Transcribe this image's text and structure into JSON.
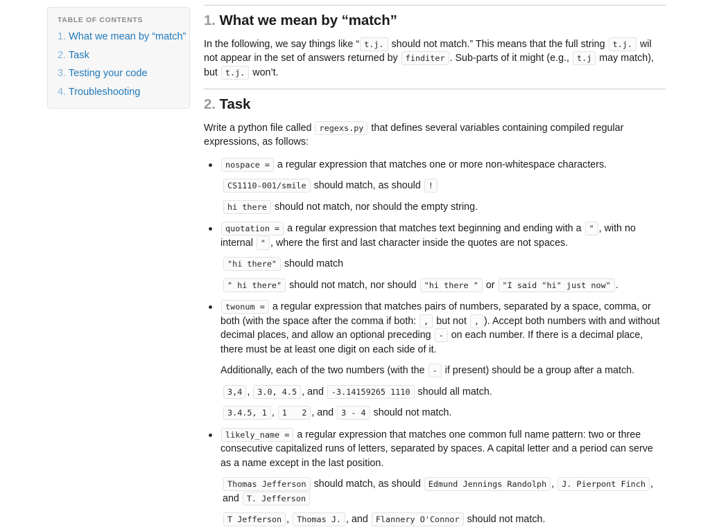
{
  "toc": {
    "title": "TABLE OF CONTENTS",
    "items": [
      {
        "num": "1.",
        "label": "What we mean by “match”"
      },
      {
        "num": "2.",
        "label": "Task"
      },
      {
        "num": "3.",
        "label": "Testing your code"
      },
      {
        "num": "4.",
        "label": "Troubleshooting"
      }
    ]
  },
  "sections": {
    "match": {
      "num": "1.",
      "title": "What we mean by “match”",
      "p1_a": "In the following, we say things like “",
      "p1_code1": "t.j.",
      "p1_b": "should not match.” This means that the full string",
      "p1_code2": "t.j.",
      "p1_c": "wil not appear in the set of answers returned by",
      "p1_code3": "finditer",
      "p1_d": ". Sub-parts of it might (e.g.,",
      "p1_code4": "t.j",
      "p1_e": "may match), but",
      "p1_code5": "t.j.",
      "p1_f": "won’t."
    },
    "task": {
      "num": "2.",
      "title": "Task",
      "intro_a": "Write a python file called",
      "intro_code": "regexs.py",
      "intro_b": "that defines several variables containing compiled regular expressions, as follows:",
      "bullets": [
        {
          "name": "nospace",
          "code": "nospace =",
          "desc": "a regular expression that matches one or more non-whitespace characters.",
          "lines": [
            {
              "parts": [
                {
                  "t": "code",
                  "v": "CS1110-001/smile"
                },
                {
                  "t": "text",
                  "v": "should match, as should"
                },
                {
                  "t": "code",
                  "v": "!"
                }
              ]
            },
            {
              "parts": [
                {
                  "t": "code",
                  "v": "hi there"
                },
                {
                  "t": "text",
                  "v": "should not match, nor should the empty string."
                }
              ]
            }
          ]
        },
        {
          "name": "quotation",
          "code": "quotation =",
          "desc_a": "a regular expression that matches text beginning and ending with a",
          "desc_code1": "\"",
          "desc_b": ", with no internal",
          "desc_code2": "\"",
          "desc_c": ", where the first and last character inside the quotes are not spaces.",
          "lines": [
            {
              "parts": [
                {
                  "t": "code",
                  "v": "\"hi there\""
                },
                {
                  "t": "text",
                  "v": "should match"
                }
              ]
            },
            {
              "parts": [
                {
                  "t": "code",
                  "v": "\" hi there\""
                },
                {
                  "t": "text",
                  "v": "should not match, nor should"
                },
                {
                  "t": "code",
                  "v": "\"hi there \""
                },
                {
                  "t": "text",
                  "v": "or"
                },
                {
                  "t": "code",
                  "v": "\"I said \"hi\" just now\""
                },
                {
                  "t": "text",
                  "v": "."
                }
              ]
            }
          ]
        },
        {
          "name": "twonum",
          "code": "twonum =",
          "desc_a": "a regular expression that matches pairs of numbers, separated by a space, comma, or both (with the space after the comma if both:",
          "desc_code1": ",",
          "desc_b": "but not",
          "desc_code2": ",",
          "desc_c": "). Accept both numbers with and without decimal places, and allow an optional preceding",
          "desc_code3": "-",
          "desc_d": "on each number. If there is a decimal place, there must be at least one digit on each side of it.",
          "extra_a": "Additionally, each of the two numbers (with the",
          "extra_code": "-",
          "extra_b": "if present) should be a group after a match.",
          "lines": [
            {
              "parts": [
                {
                  "t": "code",
                  "v": "3,4"
                },
                {
                  "t": "text",
                  "v": ","
                },
                {
                  "t": "code",
                  "v": "3.0, 4.5"
                },
                {
                  "t": "text",
                  "v": ", and"
                },
                {
                  "t": "code",
                  "v": "-3.14159265 1110"
                },
                {
                  "t": "text",
                  "v": "should all match."
                }
              ]
            },
            {
              "parts": [
                {
                  "t": "code",
                  "v": "3.4.5, 1"
                },
                {
                  "t": "text",
                  "v": ","
                },
                {
                  "t": "code",
                  "v": "1   2"
                },
                {
                  "t": "text",
                  "v": ", and"
                },
                {
                  "t": "code",
                  "v": "3 - 4"
                },
                {
                  "t": "text",
                  "v": "should not match."
                }
              ]
            }
          ]
        },
        {
          "name": "likely_name",
          "code": "likely_name =",
          "desc": "a regular expression that matches one common full name pattern: two or three consecutive capitalized runs of letters, separated by spaces. A capital letter and a period can serve as a name except in the last position.",
          "lines": [
            {
              "parts": [
                {
                  "t": "code",
                  "v": "Thomas Jefferson"
                },
                {
                  "t": "text",
                  "v": "should match, as should"
                },
                {
                  "t": "code",
                  "v": "Edmund Jennings Randolph"
                },
                {
                  "t": "text",
                  "v": ","
                },
                {
                  "t": "code",
                  "v": "J. Pierpont Finch"
                },
                {
                  "t": "text",
                  "v": ", and"
                },
                {
                  "t": "code",
                  "v": "T. Jefferson"
                }
              ]
            },
            {
              "parts": [
                {
                  "t": "code",
                  "v": "T Jefferson"
                },
                {
                  "t": "text",
                  "v": ","
                },
                {
                  "t": "code",
                  "v": "Thomas J."
                },
                {
                  "t": "text",
                  "v": ", and"
                },
                {
                  "t": "code",
                  "v": "Flannery O'Connor"
                },
                {
                  "t": "text",
                  "v": "should not match."
                }
              ]
            }
          ]
        }
      ]
    }
  },
  "colors": {
    "link": "#1f78b8",
    "link_num": "#85b4d6",
    "toc_title": "#8b8b8b",
    "section_num": "#9a9a9a",
    "code_bg": "#fbfbfb",
    "code_border": "#e1e1e1",
    "toc_bg": "#f7f7f7"
  }
}
